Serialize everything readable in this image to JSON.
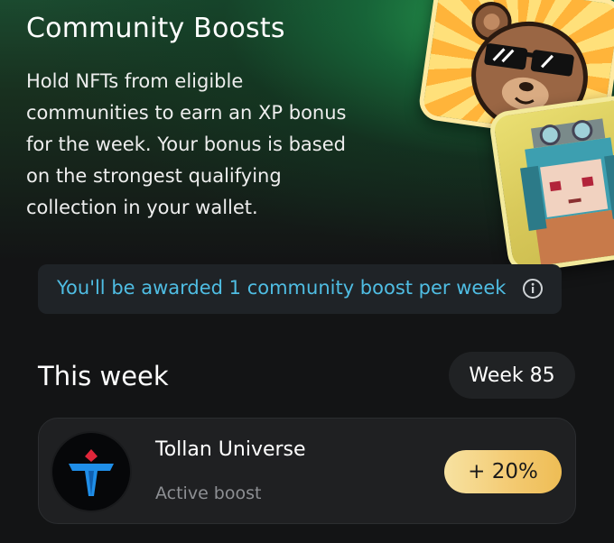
{
  "header": {
    "title": "Community Boosts",
    "description_lines": [
      "Hold NFTs from eligible",
      "communities to earn an XP bonus",
      "for the week. Your bonus is based",
      "on the strongest qualifying",
      "collection in your wallet."
    ]
  },
  "banner": {
    "text": "You'll be awarded 1 community boost per week",
    "icon": "info-icon"
  },
  "this_week": {
    "title": "This week",
    "week_label": "Week 85"
  },
  "boost": {
    "collection": "Tollan Universe",
    "status": "Active boost",
    "value": "+ 20%",
    "avatar_icon": "tollan-universe-logo"
  },
  "colors": {
    "accent_link": "#4fbde3",
    "badge_gold": "#f3c970",
    "background": "#131415",
    "card": "#1f2022"
  }
}
